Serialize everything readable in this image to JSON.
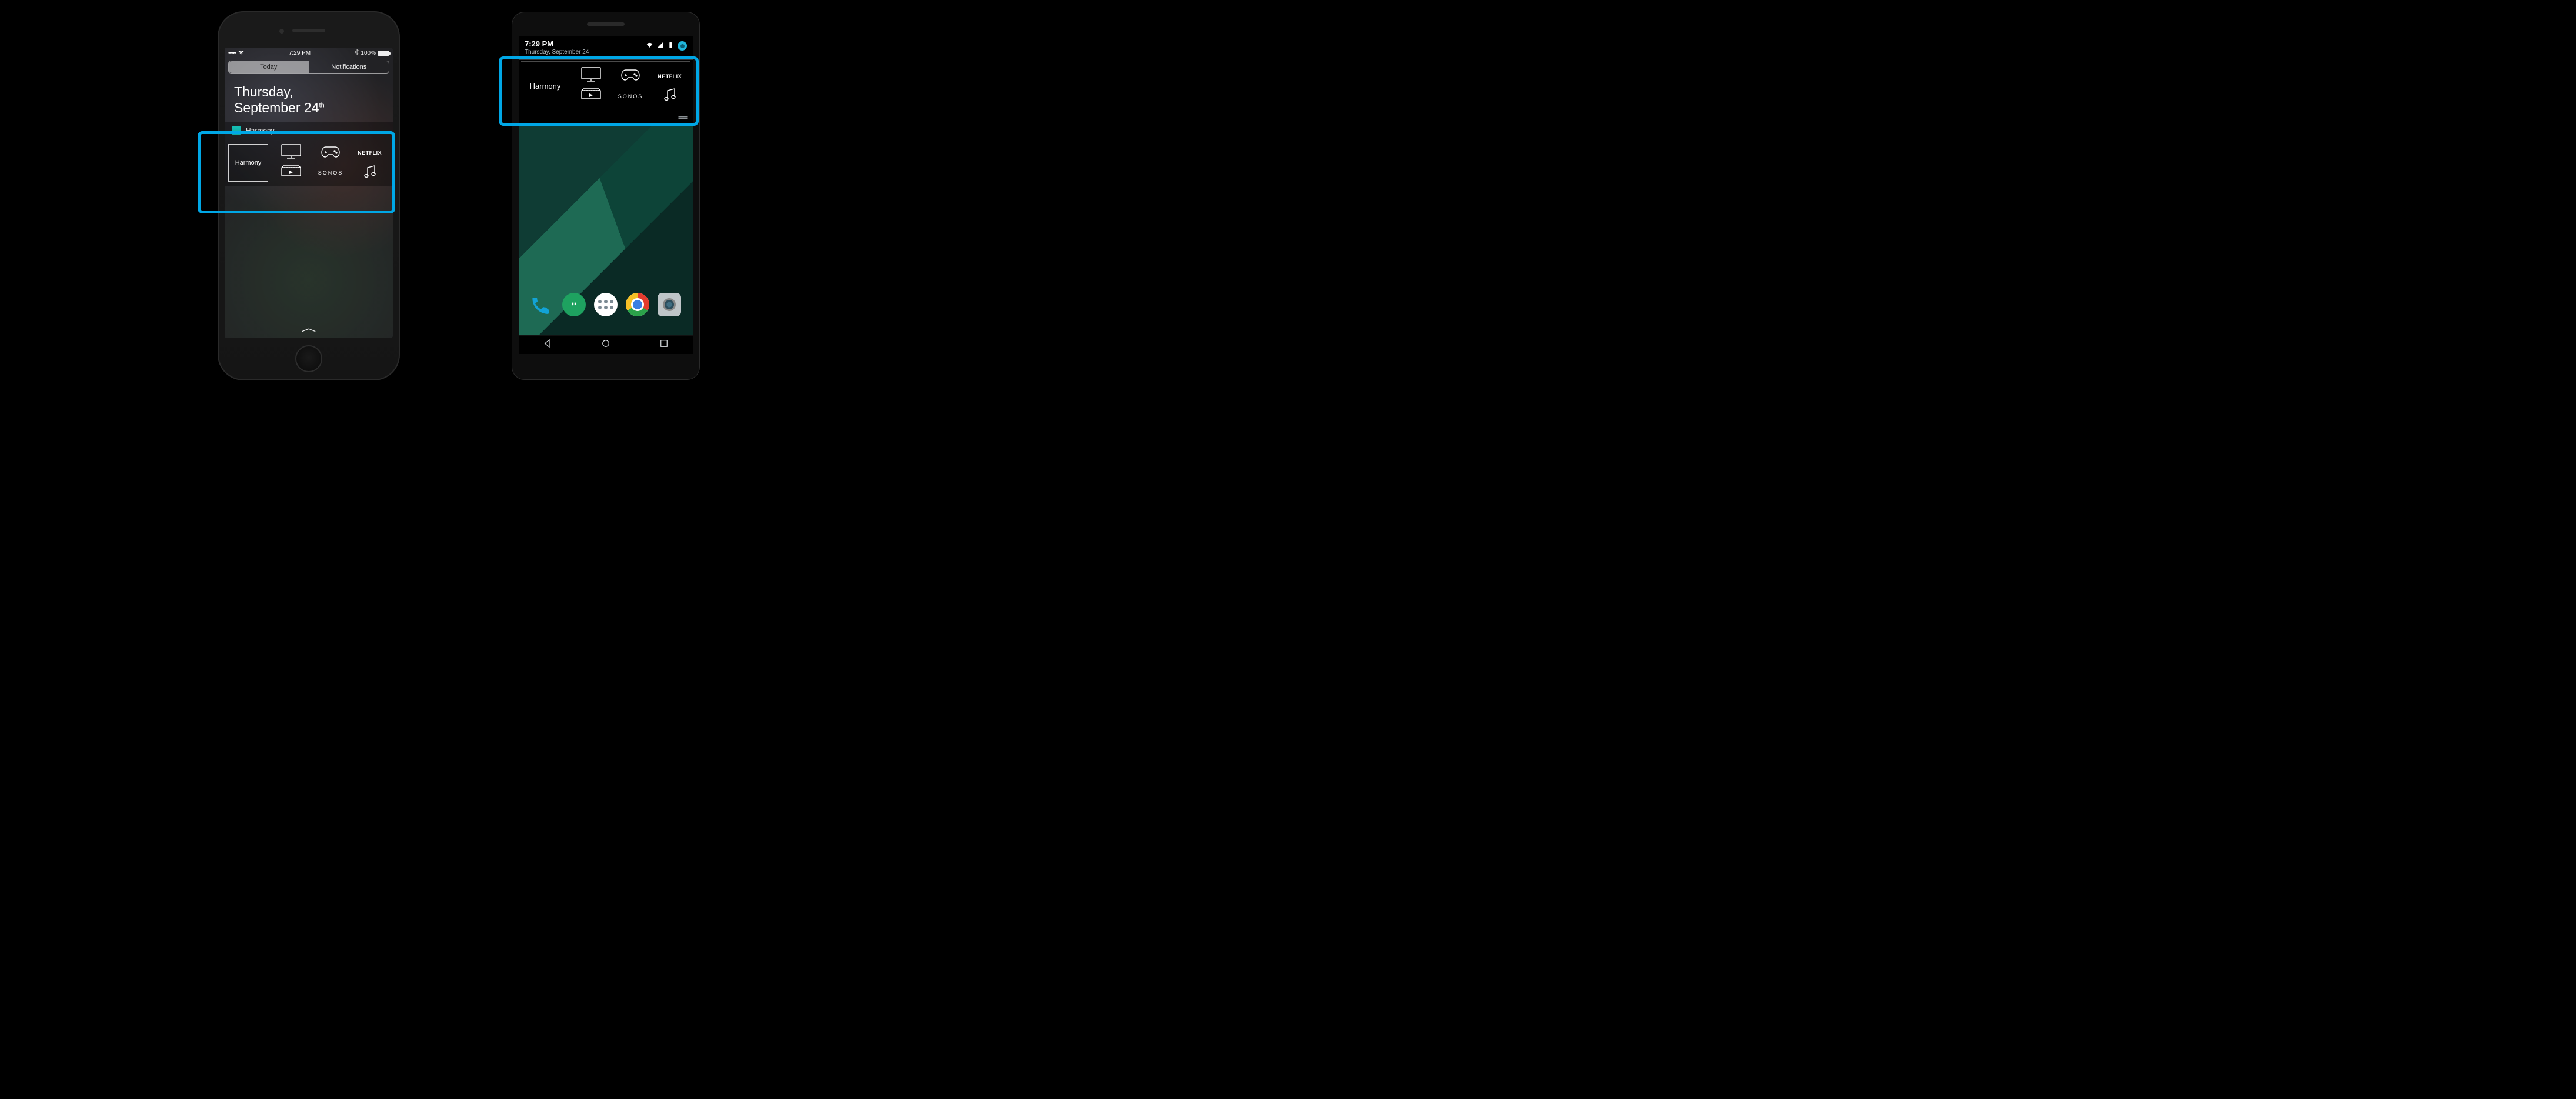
{
  "ios": {
    "status": {
      "time": "7:29 PM",
      "battery": "100%"
    },
    "tabs": {
      "today": "Today",
      "notifications": "Notifications"
    },
    "date_line1": "Thursday,",
    "date_line2a": "September 24",
    "date_line2b": "th",
    "widget_header_app": "Harmony"
  },
  "android": {
    "status": {
      "time": "7:29 PM",
      "date": "Thursday, September 24"
    }
  },
  "harmony": {
    "hub_label": "Harmony",
    "activities": {
      "tv": "tv",
      "game": "game",
      "netflix": "NETFLIX",
      "dvr": "dvr",
      "sonos": "SONOS",
      "music": "music"
    }
  },
  "colors": {
    "highlight": "#00a7e6",
    "harmony_app_icon": "#16c0b7"
  }
}
